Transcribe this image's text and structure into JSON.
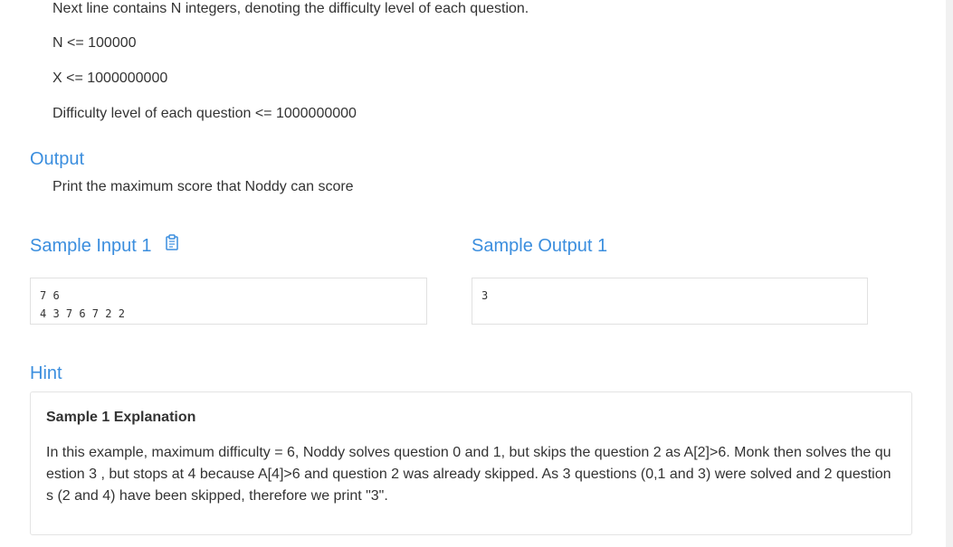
{
  "input_spec": {
    "line_difficulty": "Next line contains N integers, denoting the difficulty level of each question.",
    "constraint_n": "N <= 100000",
    "constraint_x": "X <= 1000000000",
    "constraint_difficulty": "Difficulty level of each question <= 1000000000"
  },
  "output_section": {
    "title": "Output",
    "text": "Print the maximum score that Noddy can score"
  },
  "sample_input": {
    "title": "Sample Input 1",
    "copy_icon": "clipboard-icon",
    "content": "7 6\n4 3 7 6 7 2 2"
  },
  "sample_output": {
    "title": "Sample Output 1",
    "content": "3"
  },
  "hint": {
    "title": "Hint",
    "heading": "Sample 1 Explanation",
    "text": "In this example, maximum difficulty = 6, Noddy solves question 0 and 1, but skips the question 2 as A[2]>6. Monk then solves the question 3 , but stops at 4 because A[4]>6 and question 2 was already skipped. As 3 questions (0,1 and 3) were solved and 2 questions (2 and 4) have been skipped, therefore we print \"3\"."
  },
  "colors": {
    "section_title": "#3b8ede",
    "body_text": "#333333",
    "border": "#e1e1e1"
  }
}
